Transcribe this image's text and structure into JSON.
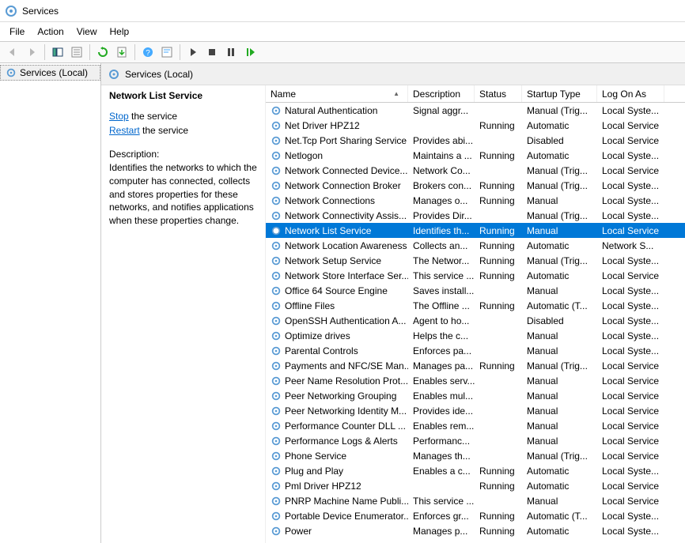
{
  "window": {
    "title": "Services"
  },
  "menubar": [
    "File",
    "Action",
    "View",
    "Help"
  ],
  "tree": {
    "root": "Services (Local)"
  },
  "rightHeader": "Services (Local)",
  "detail": {
    "title": "Network List Service",
    "stopLabel": "Stop",
    "stopSuffix": " the service",
    "restartLabel": "Restart",
    "restartSuffix": " the service",
    "descLabel": "Description:",
    "descText": "Identifies the networks to which the computer has connected, collects and stores properties for these networks, and notifies applications when these properties change."
  },
  "columns": [
    "Name",
    "Description",
    "Status",
    "Startup Type",
    "Log On As"
  ],
  "rows": [
    {
      "name": "Natural Authentication",
      "desc": "Signal aggr...",
      "status": "",
      "startup": "Manual (Trig...",
      "logon": "Local Syste..."
    },
    {
      "name": "Net Driver HPZ12",
      "desc": "",
      "status": "Running",
      "startup": "Automatic",
      "logon": "Local Service"
    },
    {
      "name": "Net.Tcp Port Sharing Service",
      "desc": "Provides abi...",
      "status": "",
      "startup": "Disabled",
      "logon": "Local Service"
    },
    {
      "name": "Netlogon",
      "desc": "Maintains a ...",
      "status": "Running",
      "startup": "Automatic",
      "logon": "Local Syste..."
    },
    {
      "name": "Network Connected Device...",
      "desc": "Network Co...",
      "status": "",
      "startup": "Manual (Trig...",
      "logon": "Local Service"
    },
    {
      "name": "Network Connection Broker",
      "desc": "Brokers con...",
      "status": "Running",
      "startup": "Manual (Trig...",
      "logon": "Local Syste..."
    },
    {
      "name": "Network Connections",
      "desc": "Manages o...",
      "status": "Running",
      "startup": "Manual",
      "logon": "Local Syste..."
    },
    {
      "name": "Network Connectivity Assis...",
      "desc": "Provides Dir...",
      "status": "",
      "startup": "Manual (Trig...",
      "logon": "Local Syste..."
    },
    {
      "name": "Network List Service",
      "desc": "Identifies th...",
      "status": "Running",
      "startup": "Manual",
      "logon": "Local Service",
      "selected": true
    },
    {
      "name": "Network Location Awareness",
      "desc": "Collects an...",
      "status": "Running",
      "startup": "Automatic",
      "logon": "Network S..."
    },
    {
      "name": "Network Setup Service",
      "desc": "The Networ...",
      "status": "Running",
      "startup": "Manual (Trig...",
      "logon": "Local Syste..."
    },
    {
      "name": "Network Store Interface Ser...",
      "desc": "This service ...",
      "status": "Running",
      "startup": "Automatic",
      "logon": "Local Service"
    },
    {
      "name": "Office 64 Source Engine",
      "desc": "Saves install...",
      "status": "",
      "startup": "Manual",
      "logon": "Local Syste..."
    },
    {
      "name": "Offline Files",
      "desc": "The Offline ...",
      "status": "Running",
      "startup": "Automatic (T...",
      "logon": "Local Syste..."
    },
    {
      "name": "OpenSSH Authentication A...",
      "desc": "Agent to ho...",
      "status": "",
      "startup": "Disabled",
      "logon": "Local Syste..."
    },
    {
      "name": "Optimize drives",
      "desc": "Helps the c...",
      "status": "",
      "startup": "Manual",
      "logon": "Local Syste..."
    },
    {
      "name": "Parental Controls",
      "desc": "Enforces pa...",
      "status": "",
      "startup": "Manual",
      "logon": "Local Syste..."
    },
    {
      "name": "Payments and NFC/SE Man...",
      "desc": "Manages pa...",
      "status": "Running",
      "startup": "Manual (Trig...",
      "logon": "Local Service"
    },
    {
      "name": "Peer Name Resolution Prot...",
      "desc": "Enables serv...",
      "status": "",
      "startup": "Manual",
      "logon": "Local Service"
    },
    {
      "name": "Peer Networking Grouping",
      "desc": "Enables mul...",
      "status": "",
      "startup": "Manual",
      "logon": "Local Service"
    },
    {
      "name": "Peer Networking Identity M...",
      "desc": "Provides ide...",
      "status": "",
      "startup": "Manual",
      "logon": "Local Service"
    },
    {
      "name": "Performance Counter DLL ...",
      "desc": "Enables rem...",
      "status": "",
      "startup": "Manual",
      "logon": "Local Service"
    },
    {
      "name": "Performance Logs & Alerts",
      "desc": "Performanc...",
      "status": "",
      "startup": "Manual",
      "logon": "Local Service"
    },
    {
      "name": "Phone Service",
      "desc": "Manages th...",
      "status": "",
      "startup": "Manual (Trig...",
      "logon": "Local Service"
    },
    {
      "name": "Plug and Play",
      "desc": "Enables a c...",
      "status": "Running",
      "startup": "Automatic",
      "logon": "Local Syste..."
    },
    {
      "name": "Pml Driver HPZ12",
      "desc": "",
      "status": "Running",
      "startup": "Automatic",
      "logon": "Local Service"
    },
    {
      "name": "PNRP Machine Name Publi...",
      "desc": "This service ...",
      "status": "",
      "startup": "Manual",
      "logon": "Local Service"
    },
    {
      "name": "Portable Device Enumerator...",
      "desc": "Enforces gr...",
      "status": "Running",
      "startup": "Automatic (T...",
      "logon": "Local Syste..."
    },
    {
      "name": "Power",
      "desc": "Manages p...",
      "status": "Running",
      "startup": "Automatic",
      "logon": "Local Syste..."
    }
  ]
}
